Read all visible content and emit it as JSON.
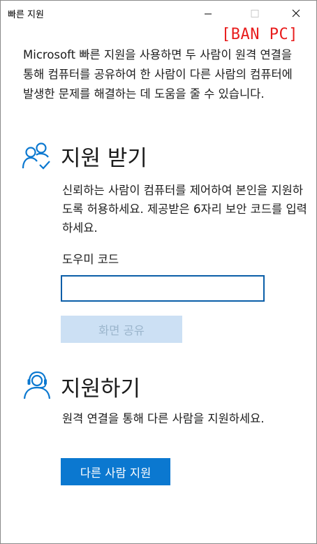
{
  "window": {
    "title": "빠른 지원",
    "controls": [
      "minimize-icon",
      "maximize-icon",
      "close-icon"
    ]
  },
  "stamp": "[BAN PC]",
  "intro": "Microsoft 빠른 지원을 사용하면 두 사람이 원격 연결을 통해 컴퓨터를 공유하여 한 사람이 다른 사람의 컴퓨터에 발생한 문제를 해결하는 데 도움을 줄 수 있습니다.",
  "get_help": {
    "icon": "people-check-icon",
    "title": "지원 받기",
    "description": "신뢰하는 사람이 컴퓨터를 제어하여 본인을 지원하도록 허용하세요. 제공받은 6자리 보안 코드를 입력하세요.",
    "code_label": "도우미 코드",
    "code_value": "",
    "share_button": "화면 공유",
    "share_enabled": false
  },
  "give_help": {
    "icon": "headset-person-icon",
    "title": "지원하기",
    "description": "원격 연결을 통해 다른 사람을 지원하세요.",
    "help_button": "다른 사람 지원"
  },
  "colors": {
    "accent": "#0b78d0",
    "input_border": "#0a5ea8",
    "disabled_bg": "#cce0f4",
    "disabled_text": "#9bb5cc",
    "stamp_red": "#e81c1c"
  }
}
